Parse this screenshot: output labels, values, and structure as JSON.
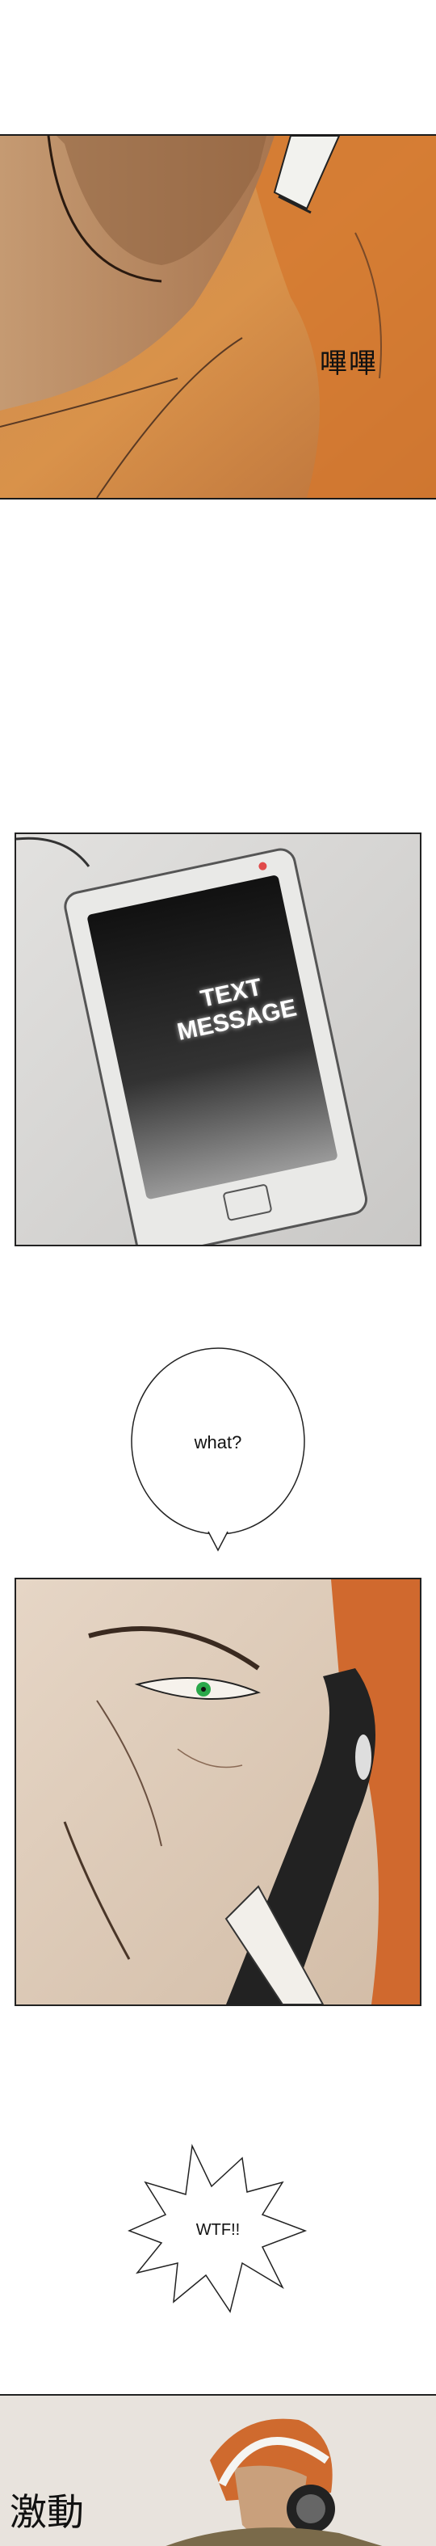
{
  "panel1": {
    "sfx": "嗶嗶"
  },
  "panel2": {
    "screen_line1": "TEXT",
    "screen_line2": "MESSAGE"
  },
  "bubble1": {
    "text": "what?"
  },
  "bubble2": {
    "text": "WTF!!"
  },
  "panel4": {
    "sfx": "激動"
  }
}
